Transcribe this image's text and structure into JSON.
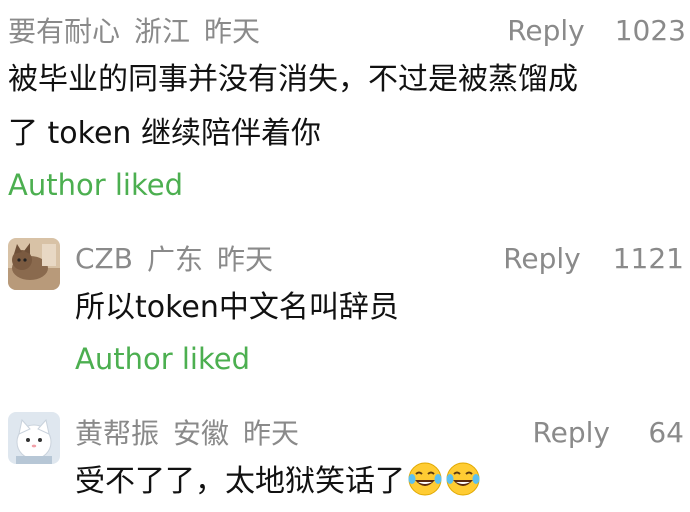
{
  "comments": [
    {
      "user": "要有耐心",
      "region": "浙江",
      "time": "昨天",
      "reply_label": "Reply",
      "likes": "1023",
      "text_line1": "被毕业的同事并没有消失，不过是被蒸馏成",
      "text_line2": "了 token 继续陪伴着你",
      "author_liked": "Author liked"
    },
    {
      "user": "CZB",
      "region": "广东",
      "time": "昨天",
      "reply_label": "Reply",
      "likes": "1121",
      "text": "所以token中文名叫辞员",
      "author_liked": "Author liked",
      "avatar_icon": "cat-photo-avatar"
    },
    {
      "user": "黄帮振",
      "region": "安徽",
      "time": "昨天",
      "reply_label": "Reply",
      "likes": "64",
      "text": "受不了了，太地狱笑话了",
      "emoji": [
        "laughing-tears-emoji",
        "laughing-tears-emoji"
      ],
      "avatar_icon": "cartoon-cat-avatar"
    }
  ],
  "colors": {
    "meta": "#8a8a8a",
    "text": "#111111",
    "author_liked": "#4caf50"
  }
}
